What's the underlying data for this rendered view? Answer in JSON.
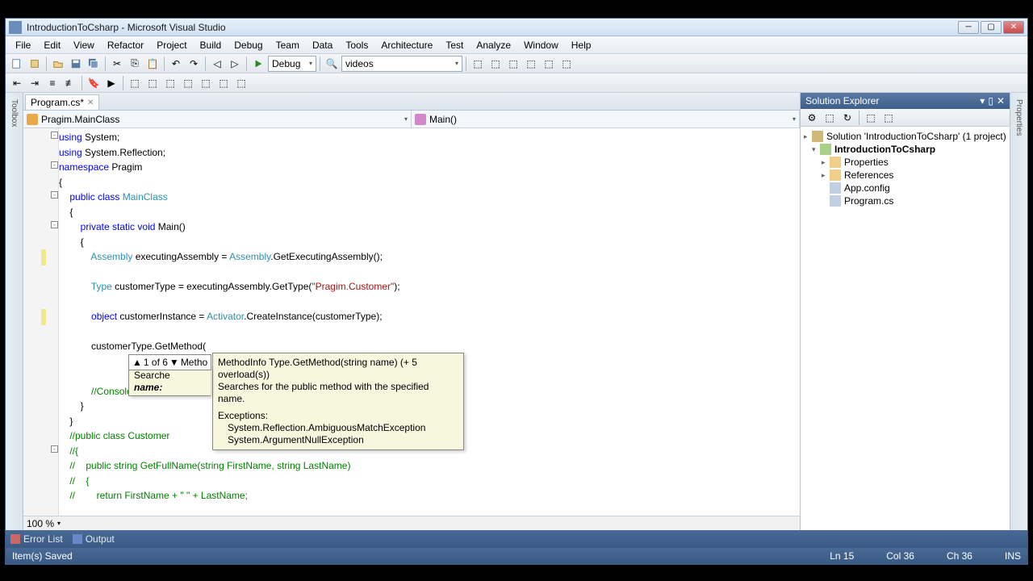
{
  "title": "IntroductionToCsharp - Microsoft Visual Studio",
  "menu": [
    "File",
    "Edit",
    "View",
    "Refactor",
    "Project",
    "Build",
    "Debug",
    "Team",
    "Data",
    "Tools",
    "Architecture",
    "Test",
    "Analyze",
    "Window",
    "Help"
  ],
  "toolbar": {
    "config": "Debug",
    "search": "videos"
  },
  "doc": {
    "tab": "Program.cs*",
    "nav_left": "Pragim.MainClass",
    "nav_right": "Main()"
  },
  "code": {
    "lines": [
      {
        "t": [
          {
            "c": "kw",
            "s": "using"
          },
          {
            "s": " System;"
          }
        ]
      },
      {
        "t": [
          {
            "c": "kw",
            "s": "using"
          },
          {
            "s": " System.Reflection;"
          }
        ]
      },
      {
        "t": [
          {
            "c": "kw",
            "s": "namespace"
          },
          {
            "s": " Pragim"
          }
        ]
      },
      {
        "t": [
          {
            "s": "{"
          }
        ]
      },
      {
        "t": [
          {
            "s": "    "
          },
          {
            "c": "kw",
            "s": "public"
          },
          {
            "s": " "
          },
          {
            "c": "kw",
            "s": "class"
          },
          {
            "s": " "
          },
          {
            "c": "typ",
            "s": "MainClass"
          }
        ]
      },
      {
        "t": [
          {
            "s": "    {"
          }
        ]
      },
      {
        "t": [
          {
            "s": "        "
          },
          {
            "c": "kw",
            "s": "private"
          },
          {
            "s": " "
          },
          {
            "c": "kw",
            "s": "static"
          },
          {
            "s": " "
          },
          {
            "c": "kw",
            "s": "void"
          },
          {
            "s": " Main()"
          }
        ]
      },
      {
        "t": [
          {
            "s": "        {"
          }
        ]
      },
      {
        "t": [
          {
            "s": "            "
          },
          {
            "c": "typ",
            "s": "Assembly"
          },
          {
            "s": " executingAssembly = "
          },
          {
            "c": "typ",
            "s": "Assembly"
          },
          {
            "s": ".GetExecutingAssembly();"
          }
        ]
      },
      {
        "t": [
          {
            "s": ""
          }
        ]
      },
      {
        "t": [
          {
            "s": "            "
          },
          {
            "c": "typ",
            "s": "Type"
          },
          {
            "s": " customerType = executingAssembly.GetType("
          },
          {
            "c": "str",
            "s": "\"Pragim.Customer\""
          },
          {
            "s": ");"
          }
        ]
      },
      {
        "t": [
          {
            "s": ""
          }
        ]
      },
      {
        "t": [
          {
            "s": "            "
          },
          {
            "c": "kw",
            "s": "object"
          },
          {
            "s": " customerInstance = "
          },
          {
            "c": "typ",
            "s": "Activator"
          },
          {
            "s": ".CreateInstance(customerType);"
          }
        ]
      },
      {
        "t": [
          {
            "s": ""
          }
        ]
      },
      {
        "t": [
          {
            "s": "            customerType.GetMethod("
          }
        ]
      },
      {
        "t": [
          {
            "s": ""
          }
        ]
      },
      {
        "t": [
          {
            "s": ""
          }
        ]
      },
      {
        "t": [
          {
            "s": "            "
          },
          {
            "c": "cmt",
            "s": "//Console.Wri"
          }
        ]
      },
      {
        "t": [
          {
            "s": "        }"
          }
        ]
      },
      {
        "t": [
          {
            "s": "    }"
          }
        ]
      },
      {
        "t": [
          {
            "s": "    "
          },
          {
            "c": "cmt",
            "s": "//public class Customer"
          }
        ]
      },
      {
        "t": [
          {
            "s": "    "
          },
          {
            "c": "cmt",
            "s": "//{"
          }
        ]
      },
      {
        "t": [
          {
            "s": "    "
          },
          {
            "c": "cmt",
            "s": "//    public string GetFullName(string FirstName, string LastName)"
          }
        ]
      },
      {
        "t": [
          {
            "s": "    "
          },
          {
            "c": "cmt",
            "s": "//    {"
          }
        ]
      },
      {
        "t": [
          {
            "s": "    "
          },
          {
            "c": "cmt",
            "s": "//        return FirstName + \" \" + LastName;"
          }
        ]
      }
    ]
  },
  "tooltip": {
    "nav": "1 of 6",
    "nav_label": "Metho",
    "sig": "MethodInfo Type.GetMethod(string name)  (+ 5 overload(s))",
    "desc": "Searches for the public method with the specified name.",
    "param_label": "name:",
    "exc_label": "Exceptions:",
    "exc1": "System.Reflection.AmbiguousMatchException",
    "exc2": "System.ArgumentNullException",
    "search_label": "Searche"
  },
  "zoom": "100 %",
  "solution": {
    "title": "Solution Explorer",
    "root": "Solution 'IntroductionToCsharp' (1 project)",
    "project": "IntroductionToCsharp",
    "items": [
      "Properties",
      "References",
      "App.config",
      "Program.cs"
    ]
  },
  "right_tabs": [
    "Properties"
  ],
  "left_tabs": [
    "Toolbox"
  ],
  "bottom": {
    "error": "Error List",
    "output": "Output"
  },
  "status": {
    "msg": "Item(s) Saved",
    "ln": "Ln 15",
    "col": "Col 36",
    "ch": "Ch 36",
    "ins": "INS"
  }
}
